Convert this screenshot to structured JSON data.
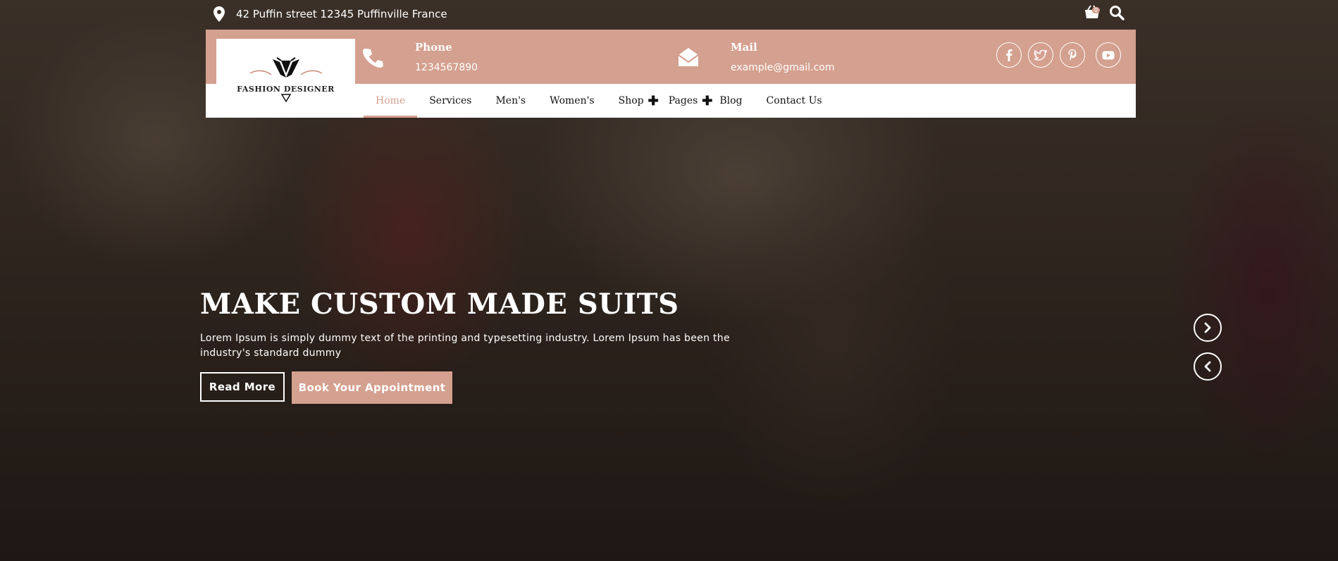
{
  "colors": {
    "accent": "#d4a08f",
    "text_light": "#ffffff",
    "nav_text": "#111111"
  },
  "topbar": {
    "address": "42 Puffin street 12345 Puffinville France",
    "address_icon": "map-marker-icon",
    "cart_icon": "shopping-basket-icon",
    "cart_count": "0",
    "search_icon": "search-icon"
  },
  "header": {
    "logo_text": "FASHION DESIGNER",
    "phone": {
      "icon": "phone-icon",
      "label": "Phone",
      "value": "1234567890"
    },
    "mail": {
      "icon": "envelope-open-icon",
      "label": "Mail",
      "value": "example@gmail.com"
    },
    "social": [
      "facebook-icon",
      "twitter-icon",
      "pinterest-icon",
      "youtube-icon"
    ]
  },
  "nav": {
    "items": [
      {
        "label": "Home",
        "active": true
      },
      {
        "label": "Services"
      },
      {
        "label": "Men's"
      },
      {
        "label": "Women's"
      },
      {
        "label": "Shop",
        "dropdown": true
      },
      {
        "label": "Pages",
        "dropdown": true
      },
      {
        "label": "Blog"
      },
      {
        "label": "Contact Us"
      }
    ]
  },
  "hero": {
    "title": "MAKE CUSTOM MADE SUITS",
    "subtitle": "Lorem Ipsum is simply dummy text of the printing and typesetting industry. Lorem Ipsum has been the industry's standard dummy",
    "read_more": "Read More",
    "book": "Book Your Appointment",
    "next_icon": "chevron-right-icon",
    "prev_icon": "chevron-left-icon"
  }
}
